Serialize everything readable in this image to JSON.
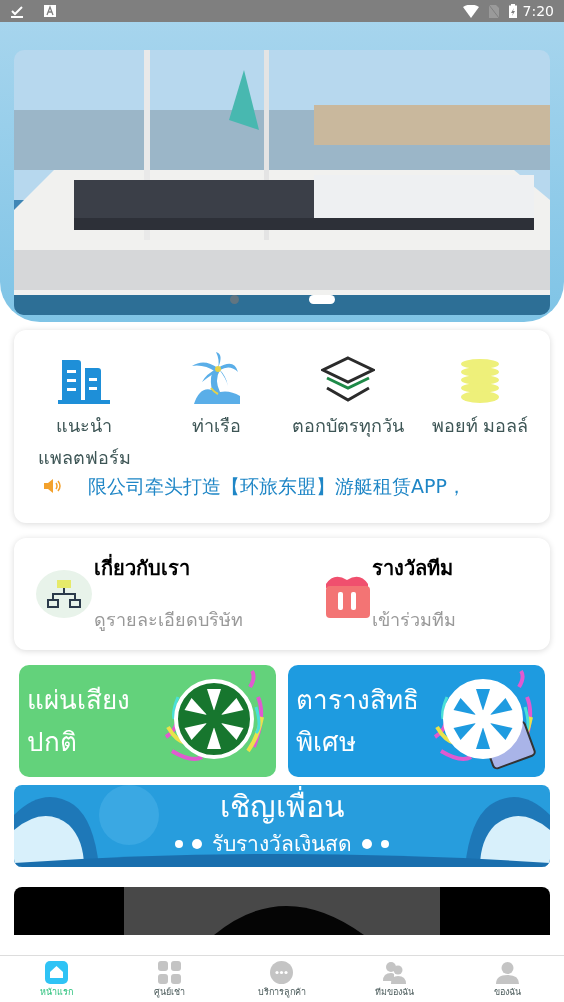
{
  "status_bar": {
    "time": "7:20"
  },
  "banner": {
    "dots": [
      {
        "selected": false
      },
      {
        "selected": true
      }
    ]
  },
  "menu": {
    "items": [
      {
        "kind": "buildings",
        "lines": [
          "แนะนำ",
          "แพลตฟอร์ม"
        ]
      },
      {
        "kind": "palm",
        "lines": [
          "ท่าเรือ"
        ]
      },
      {
        "kind": "layers",
        "lines": [
          "ตอกบัตรทุกวัน"
        ]
      },
      {
        "kind": "coins",
        "lines": [
          "พอยท์ มอลล์"
        ]
      }
    ],
    "notice": "限公司牵头打造【环旅东盟】游艇租赁APP，"
  },
  "info_cards": [
    {
      "kind": "org",
      "title": "เกี่ยวกับเรา",
      "subtitle": "ดูรายละเอียดบริษัท"
    },
    {
      "kind": "gift",
      "title": "รางวัลทีม",
      "subtitle": "เข้าร่วมทีม"
    }
  ],
  "promo_tiles": [
    {
      "color": "#63d27b",
      "lines": [
        "แผ่นเสียง",
        "ปกติ"
      ]
    },
    {
      "color": "#1e9be0",
      "lines": [
        "ตารางสิทธิ",
        "พิเศษ"
      ]
    }
  ],
  "invite": {
    "title": "เชิญเพื่อน",
    "subtitle": "รับรางวัลเงินสด"
  },
  "nav": [
    {
      "kind": "home",
      "label": "หน้าแรก",
      "selected": true
    },
    {
      "kind": "grid",
      "label": "ศูนย์เช่า",
      "selected": false
    },
    {
      "kind": "chat",
      "label": "บริการลูกค้า",
      "selected": false
    },
    {
      "kind": "team",
      "label": "ทีมของฉัน",
      "selected": false
    },
    {
      "kind": "user",
      "label": "ของฉัน",
      "selected": false
    }
  ]
}
